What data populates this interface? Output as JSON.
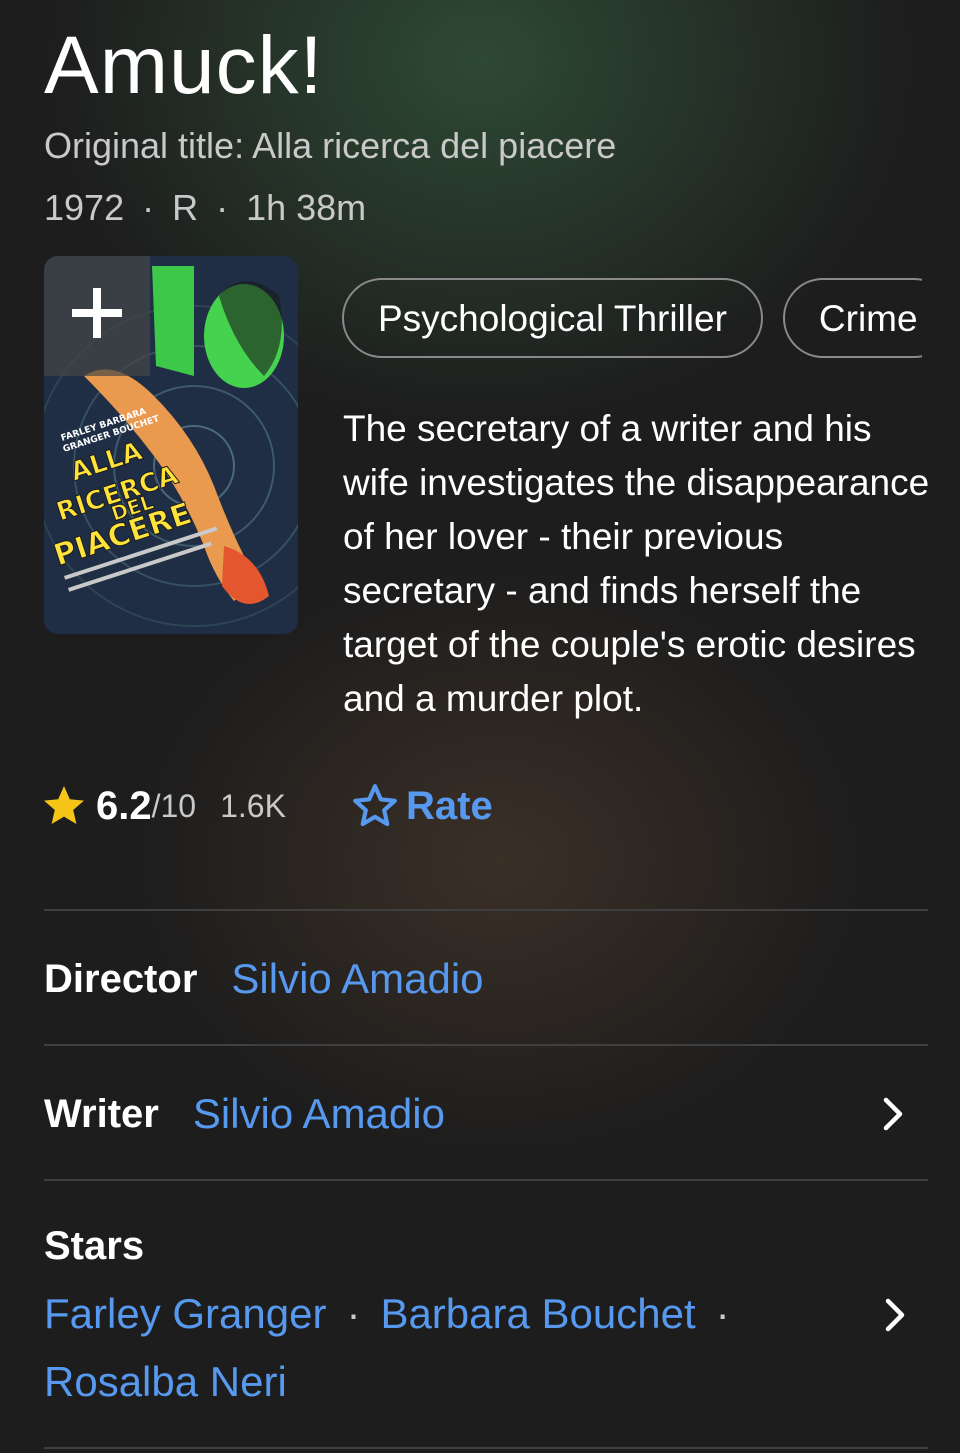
{
  "title": "Amuck!",
  "original_title": "Original title: Alla ricerca del piacere",
  "meta": {
    "year": "1972",
    "rating": "R",
    "runtime": "1h 38m"
  },
  "poster": {
    "text_lines": [
      "ALLA",
      "RICERCA",
      "DEL",
      "PIACERE"
    ],
    "credit_names": [
      "FARLEY BARBARA",
      "GRANGER BOUCHET"
    ]
  },
  "genres": [
    "Psychological Thriller",
    "Crime"
  ],
  "plot": "The secretary of a writer and his wife investigates the disappearance of her lover - their previous secretary - and finds herself the target of the couple's erotic desires and a murder plot.",
  "user_rating": {
    "score": "6.2",
    "out_of": "/10",
    "votes": "1.6K"
  },
  "rate_label": "Rate",
  "director": {
    "label": "Director",
    "name": "Silvio Amadio"
  },
  "writer": {
    "label": "Writer",
    "name": "Silvio Amadio"
  },
  "stars": {
    "label": "Stars",
    "names": [
      "Farley Granger",
      "Barbara Bouchet",
      "Rosalba Neri"
    ]
  },
  "colors": {
    "accent_link": "#5799ef",
    "star_gold": "#f5c518",
    "divider": "#3f3f3f"
  }
}
